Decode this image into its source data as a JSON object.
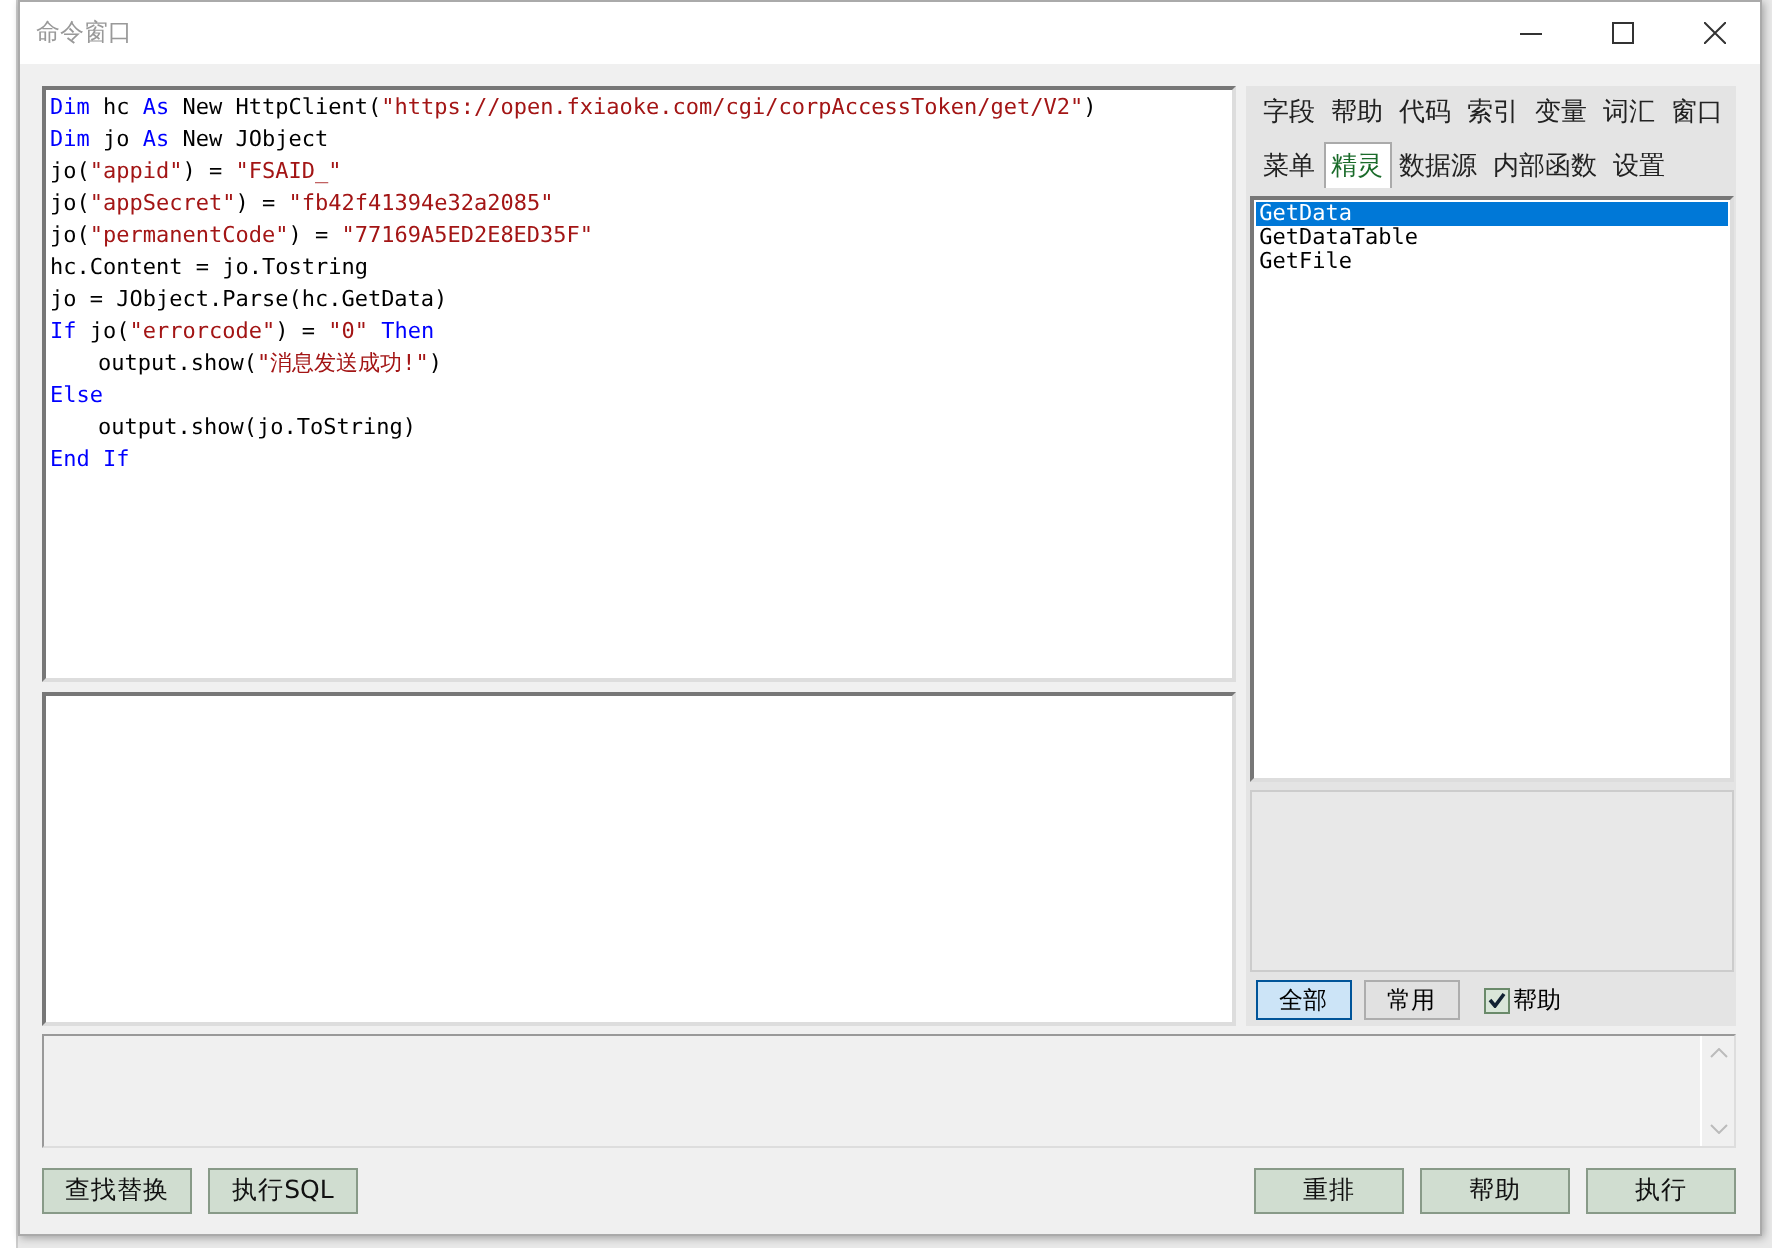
{
  "window": {
    "title": "命令窗口"
  },
  "code_lines": [
    {
      "indent": false,
      "tokens": [
        {
          "kind": "keyword",
          "text": "Dim"
        },
        {
          "kind": "plain",
          "text": " hc "
        },
        {
          "kind": "keyword",
          "text": "As"
        },
        {
          "kind": "plain",
          "text": " New HttpClient("
        },
        {
          "kind": "string",
          "text": "\"https://open.fxiaoke.com/cgi/corpAccessToken/get/V2\""
        },
        {
          "kind": "plain",
          "text": ")"
        }
      ]
    },
    {
      "indent": false,
      "tokens": [
        {
          "kind": "keyword",
          "text": "Dim"
        },
        {
          "kind": "plain",
          "text": " jo "
        },
        {
          "kind": "keyword",
          "text": "As"
        },
        {
          "kind": "plain",
          "text": " New JObject"
        }
      ]
    },
    {
      "indent": false,
      "tokens": [
        {
          "kind": "plain",
          "text": "jo("
        },
        {
          "kind": "string",
          "text": "\"appid\""
        },
        {
          "kind": "plain",
          "text": ") = "
        },
        {
          "kind": "string",
          "text": "\"FSAID_\""
        }
      ]
    },
    {
      "indent": false,
      "tokens": [
        {
          "kind": "plain",
          "text": "jo("
        },
        {
          "kind": "string",
          "text": "\"appSecret\""
        },
        {
          "kind": "plain",
          "text": ") = "
        },
        {
          "kind": "string",
          "text": "\"fb42f41394e32a2085\""
        }
      ]
    },
    {
      "indent": false,
      "tokens": [
        {
          "kind": "plain",
          "text": "jo("
        },
        {
          "kind": "string",
          "text": "\"permanentCode\""
        },
        {
          "kind": "plain",
          "text": ") = "
        },
        {
          "kind": "string",
          "text": "\"77169A5ED2E8ED35F\""
        }
      ]
    },
    {
      "indent": false,
      "tokens": [
        {
          "kind": "plain",
          "text": "hc.Content = jo.Tostring"
        }
      ]
    },
    {
      "indent": false,
      "tokens": [
        {
          "kind": "plain",
          "text": "jo = JObject.Parse(hc.GetData)"
        }
      ]
    },
    {
      "indent": false,
      "tokens": [
        {
          "kind": "keyword",
          "text": "If"
        },
        {
          "kind": "plain",
          "text": " jo("
        },
        {
          "kind": "string",
          "text": "\"errorcode\""
        },
        {
          "kind": "plain",
          "text": ") = "
        },
        {
          "kind": "string",
          "text": "\"0\""
        },
        {
          "kind": "keyword",
          "text": " Then"
        }
      ]
    },
    {
      "indent": true,
      "tokens": [
        {
          "kind": "plain",
          "text": "output.show("
        },
        {
          "kind": "string",
          "text": "\"消息发送成功!\""
        },
        {
          "kind": "plain",
          "text": ")"
        }
      ]
    },
    {
      "indent": false,
      "tokens": [
        {
          "kind": "keyword",
          "text": "Else"
        }
      ]
    },
    {
      "indent": true,
      "tokens": [
        {
          "kind": "plain",
          "text": "output.show(jo.ToString)"
        }
      ]
    },
    {
      "indent": false,
      "tokens": [
        {
          "kind": "keyword",
          "text": "End If"
        }
      ]
    }
  ],
  "tab_rows": [
    [
      {
        "label": "字段",
        "selected": false
      },
      {
        "label": "帮助",
        "selected": false
      },
      {
        "label": "代码",
        "selected": false
      },
      {
        "label": "索引",
        "selected": false
      },
      {
        "label": "变量",
        "selected": false
      },
      {
        "label": "词汇",
        "selected": false
      },
      {
        "label": "窗口",
        "selected": false
      }
    ],
    [
      {
        "label": "菜单",
        "selected": false
      },
      {
        "label": "精灵",
        "selected": true
      },
      {
        "label": "数据源",
        "selected": false
      },
      {
        "label": "内部函数",
        "selected": false
      },
      {
        "label": "设置",
        "selected": false
      }
    ]
  ],
  "list_items": [
    {
      "label": "GetData",
      "selected": true
    },
    {
      "label": "GetDataTable",
      "selected": false
    },
    {
      "label": "GetFile",
      "selected": false
    }
  ],
  "filter_buttons": [
    {
      "label": "全部",
      "selected": true
    },
    {
      "label": "常用",
      "selected": false
    }
  ],
  "help_checkbox": {
    "label": "帮助",
    "checked": true
  },
  "left_buttons": [
    "查找替换",
    "执行SQL"
  ],
  "right_buttons": [
    "重排",
    "帮助",
    "执行"
  ]
}
